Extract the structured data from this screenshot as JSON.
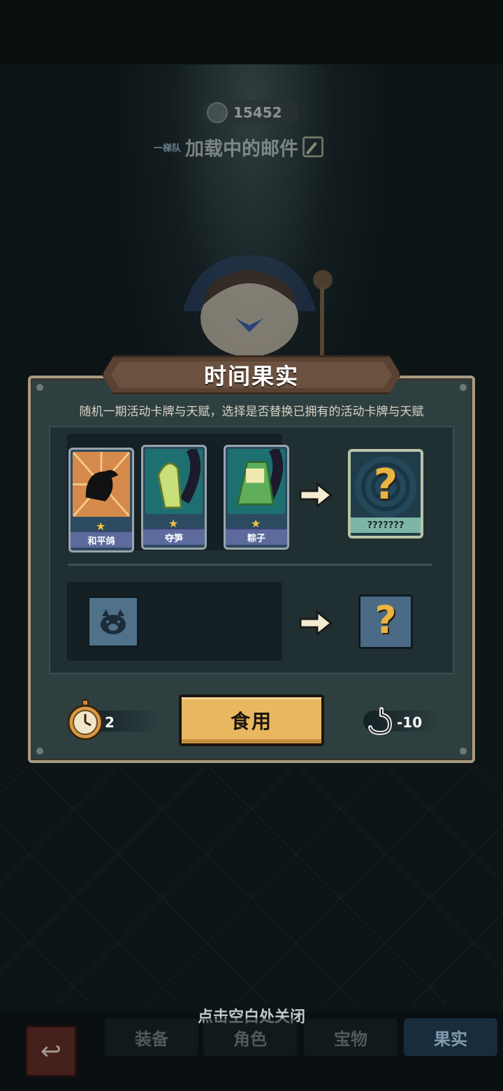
{
  "currency": {
    "value": "15452"
  },
  "team": {
    "tag": "一梯队",
    "title": "加载中的邮件"
  },
  "modal": {
    "title": "时间果实",
    "description": "随机一期活动卡牌与天赋，选择是否替换已拥有的活动卡牌与天赋",
    "cards": [
      {
        "name": "和平鸽",
        "stars": 1
      },
      {
        "name": "夺笋",
        "stars": 1
      },
      {
        "name": "粽子",
        "stars": 1
      }
    ],
    "result_card": {
      "name": "???????",
      "symbol": "?"
    },
    "talent_result": {
      "symbol": "?"
    },
    "cost_left": {
      "value": "2",
      "icon": "pocket-watch-icon"
    },
    "cost_right": {
      "value": "-10",
      "icon": "stomach-icon"
    },
    "eat_button": "食用"
  },
  "close_hint": "点击空白处关闭",
  "bottom_tabs": [
    {
      "label": "装备"
    },
    {
      "label": "角色"
    },
    {
      "label": "宝物"
    },
    {
      "label": "果实"
    }
  ],
  "colors": {
    "accent": "#e8b760",
    "modal_bg": "#2e3f40",
    "question": "#e9b441"
  }
}
